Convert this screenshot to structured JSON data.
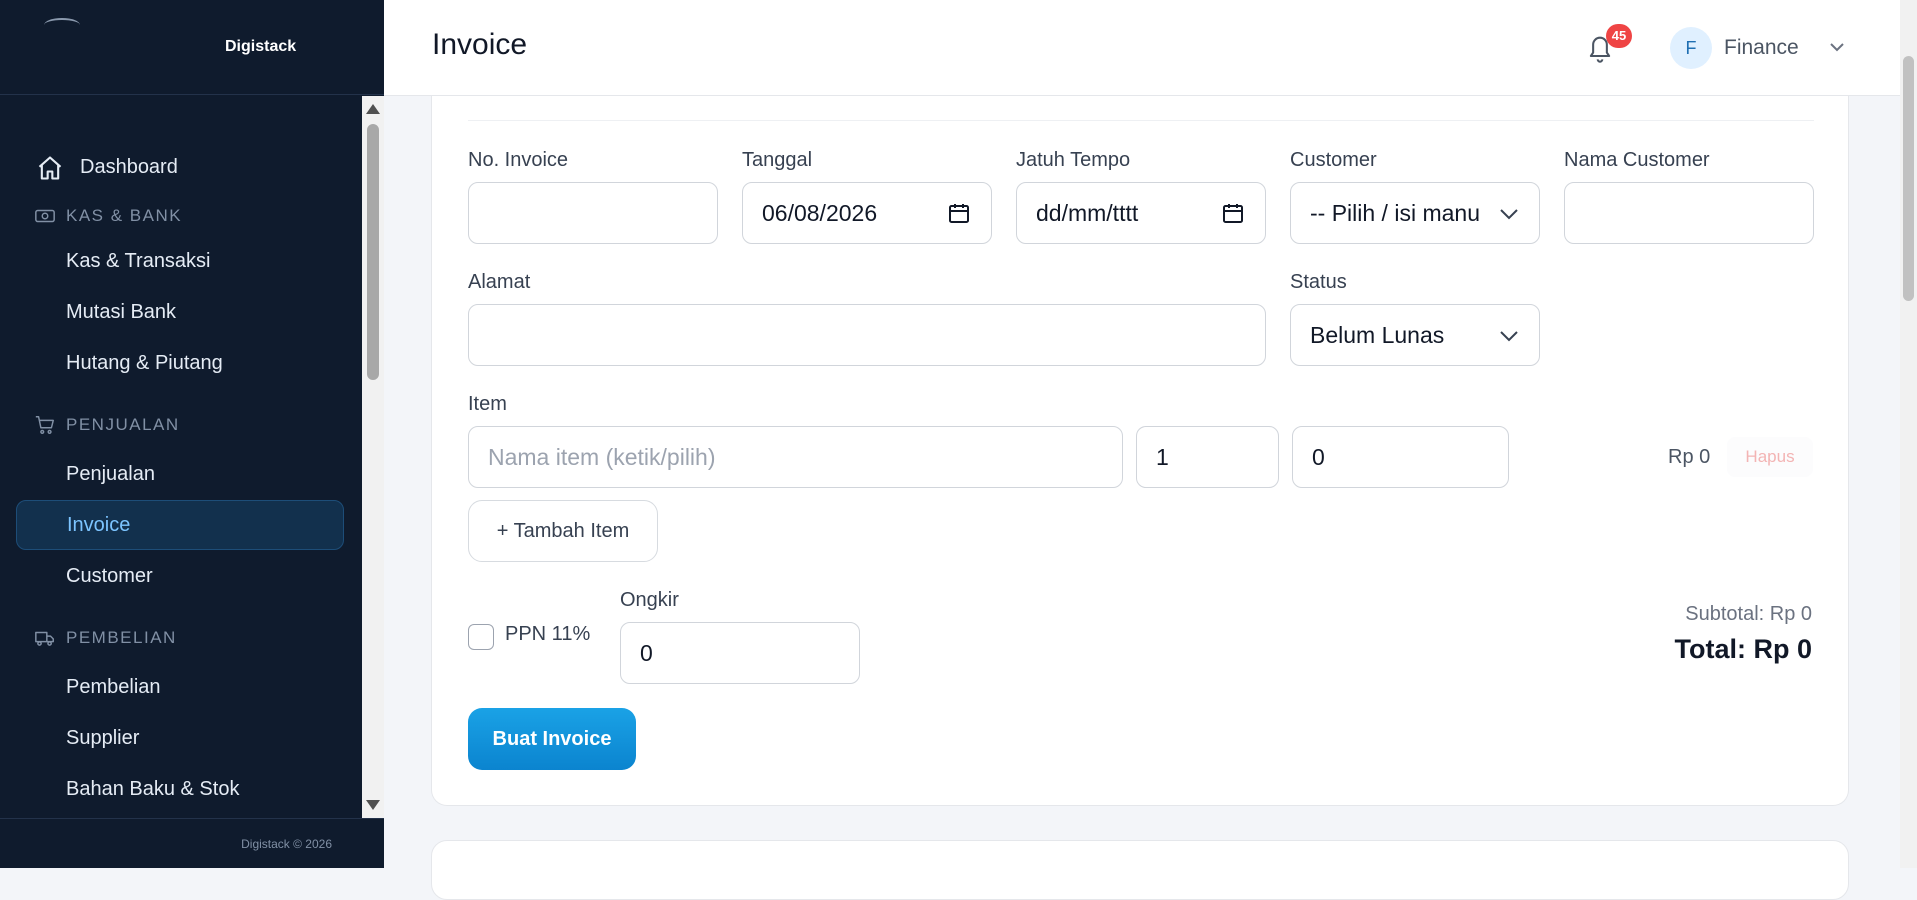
{
  "brand": {
    "name": "Digistack"
  },
  "sidebar": {
    "dashboard": "Dashboard",
    "sections": [
      {
        "title": "KAS & BANK",
        "items": [
          "Kas & Transaksi",
          "Mutasi Bank",
          "Hutang & Piutang"
        ]
      },
      {
        "title": "PENJUALAN",
        "items": [
          "Penjualan",
          "Invoice",
          "Customer"
        ]
      },
      {
        "title": "PEMBELIAN",
        "items": [
          "Pembelian",
          "Supplier",
          "Bahan Baku & Stok"
        ]
      }
    ],
    "active_item": "Invoice",
    "footer": "Digistack © 2026"
  },
  "header": {
    "title": "Invoice",
    "notification_count": "45",
    "user_initial": "F",
    "user_name": "Finance"
  },
  "form": {
    "no_invoice": {
      "label": "No. Invoice",
      "value": ""
    },
    "tanggal": {
      "label": "Tanggal",
      "value": "06/08/2026"
    },
    "jatuh_tempo": {
      "label": "Jatuh Tempo",
      "value": "dd/mm/tttt"
    },
    "customer": {
      "label": "Customer",
      "selected": "-- Pilih / isi manu"
    },
    "nama_customer": {
      "label": "Nama Customer",
      "value": ""
    },
    "alamat": {
      "label": "Alamat",
      "value": ""
    },
    "status": {
      "label": "Status",
      "selected": "Belum Lunas"
    },
    "item": {
      "label": "Item",
      "name_placeholder": "Nama item (ketik/pilih)",
      "qty": "1",
      "price": "0",
      "line_total": "Rp 0",
      "delete_label": "Hapus"
    },
    "add_item_label": "+ Tambah Item",
    "ppn_label": "PPN 11%",
    "ppn_checked": false,
    "ongkir": {
      "label": "Ongkir",
      "value": "0"
    },
    "subtotal": "Subtotal: Rp 0",
    "total": "Total: Rp 0",
    "submit_label": "Buat Invoice"
  },
  "colors": {
    "sidebar_bg": "#0f1b2d",
    "active_item_bg": "#12304d",
    "active_item_text": "#7cc4ff",
    "primary_button": "#0b84cf",
    "badge": "#ef4444"
  }
}
